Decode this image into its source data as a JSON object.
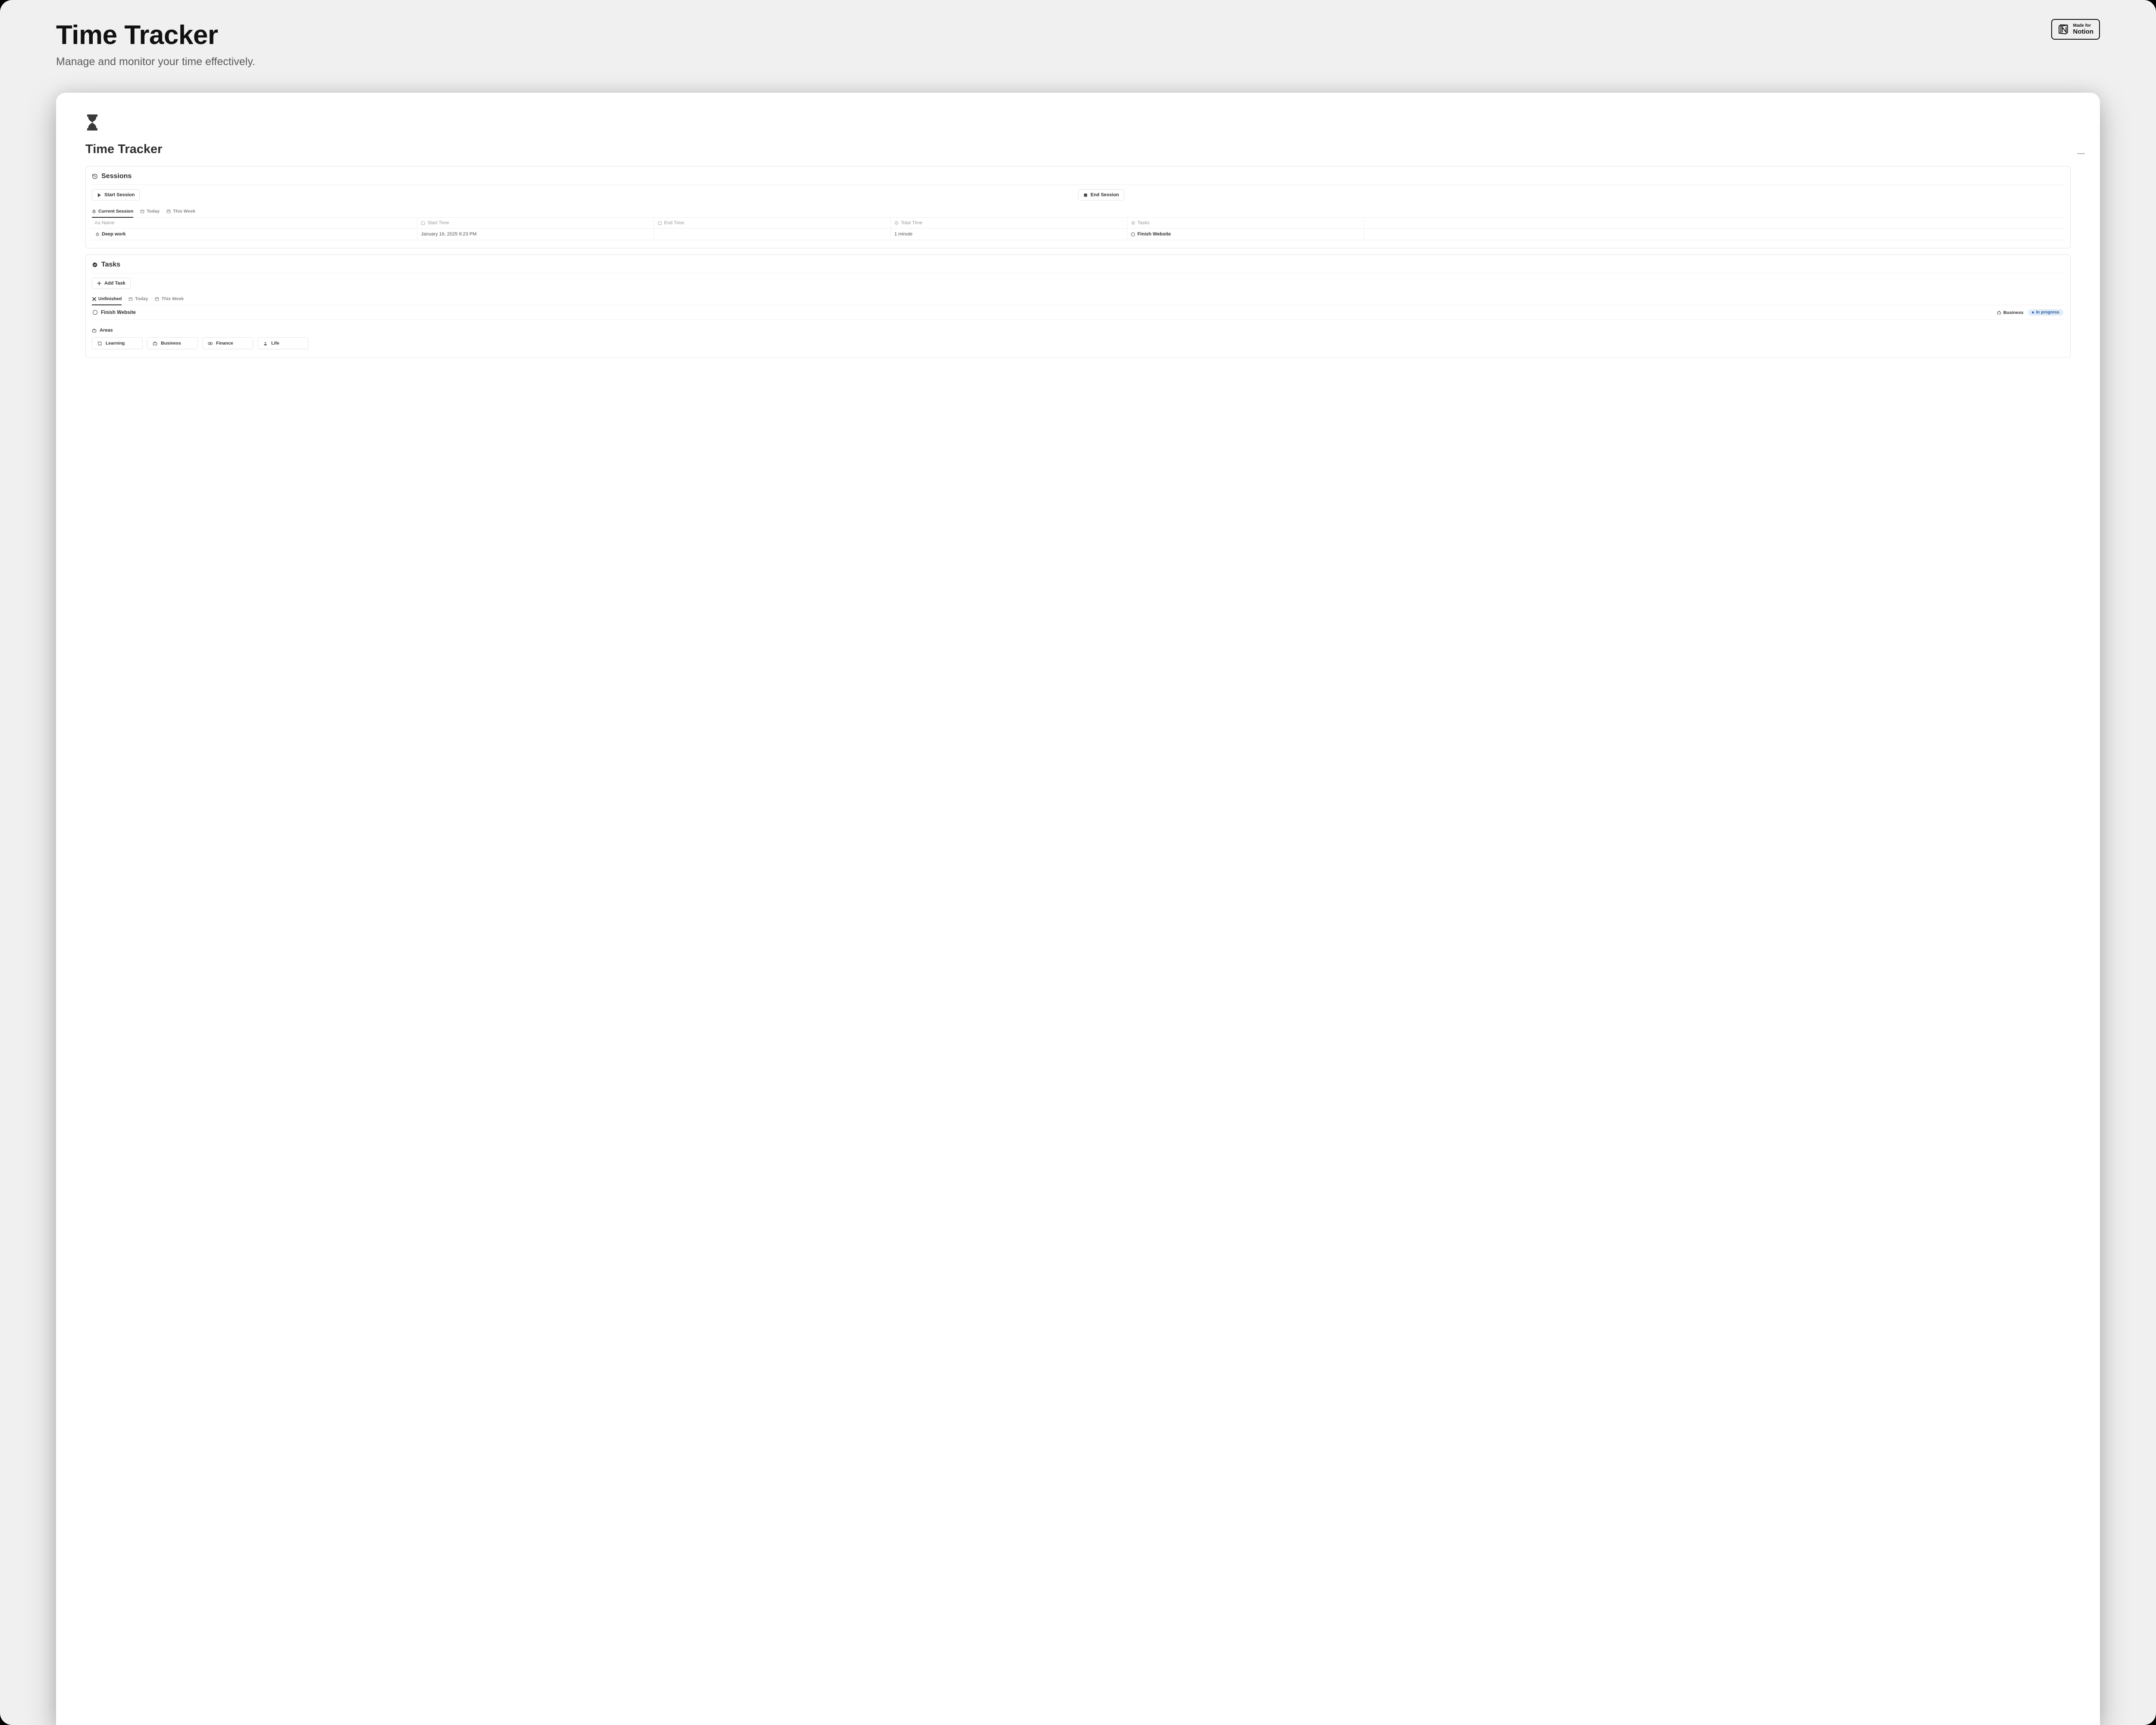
{
  "hero": {
    "title": "Time Tracker",
    "subtitle": "Manage and monitor your time effectively."
  },
  "made_for": {
    "line1": "Made for",
    "line2": "Notion"
  },
  "page": {
    "title": "Time Tracker"
  },
  "sessions": {
    "title": "Sessions",
    "start_btn": "Start Session",
    "end_btn": "End Session",
    "tabs": {
      "current": "Current Session",
      "today": "Today",
      "week": "This Week"
    },
    "columns": {
      "name": "Name",
      "start": "Start Time",
      "end": "End Time",
      "total": "Total Time",
      "tasks": "Tasks"
    },
    "row": {
      "name": "Deep work",
      "start": "January 16, 2025 9:23 PM",
      "end": "",
      "total": "1 minute",
      "task": "Finish Website"
    }
  },
  "tasks": {
    "title": "Tasks",
    "add_btn": "Add Task",
    "tabs": {
      "unfinished": "Unfinished",
      "today": "Today",
      "week": "This Week"
    },
    "item": {
      "name": "Finish Website",
      "category": "Business",
      "status": "In progress"
    },
    "areas_label": "Areas",
    "areas": {
      "learning": "Learning",
      "business": "Business",
      "finance": "Finance",
      "life": "Life"
    }
  }
}
